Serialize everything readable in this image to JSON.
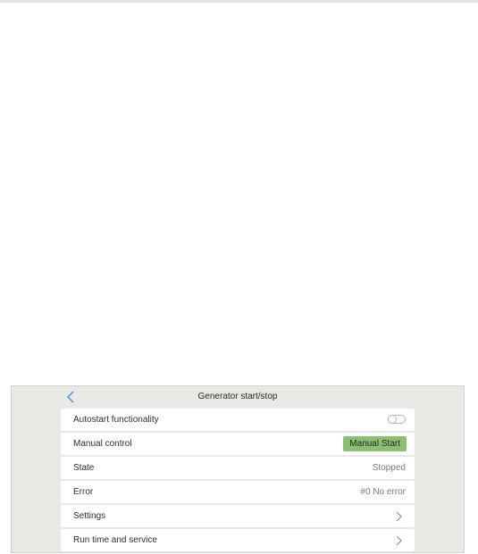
{
  "header": {
    "title": "Generator start/stop",
    "back_icon": "chevron-left-icon"
  },
  "rows": [
    {
      "label": "Autostart functionality",
      "control": "toggle",
      "toggle_on": false
    },
    {
      "label": "Manual control",
      "control": "button",
      "button_label": "Manual Start"
    },
    {
      "label": "State",
      "value": "Stopped"
    },
    {
      "label": "Error",
      "value": "#0 No error"
    },
    {
      "label": "Settings",
      "control": "chevron-right-icon"
    },
    {
      "label": "Run time and service",
      "control": "chevron-right-icon"
    }
  ],
  "colors": {
    "accent_blue": "#4a8fd9",
    "start_button_green": "#8cbf72",
    "panel_background": "#e8e8e5"
  }
}
